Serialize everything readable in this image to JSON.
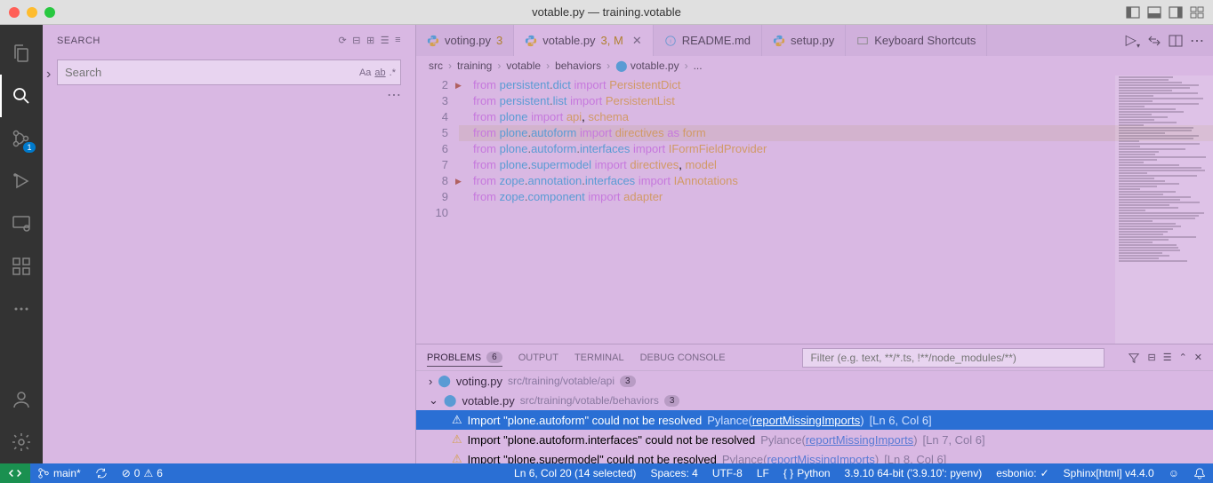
{
  "titlebar": {
    "title": "votable.py — training.votable"
  },
  "activity_bar": {
    "scm_badge": "1"
  },
  "sidebar": {
    "title": "SEARCH",
    "search_placeholder": "Search"
  },
  "tabs": [
    {
      "label": "voting.py",
      "badge": "3",
      "active": false,
      "icon": "python"
    },
    {
      "label": "votable.py",
      "badge": "3, M",
      "active": true,
      "icon": "python"
    },
    {
      "label": "README.md",
      "badge": "",
      "active": false,
      "icon": "markdown"
    },
    {
      "label": "setup.py",
      "badge": "",
      "active": false,
      "icon": "python"
    },
    {
      "label": "Keyboard Shortcuts",
      "badge": "",
      "active": false,
      "icon": "kb"
    }
  ],
  "breadcrumb": [
    "src",
    "training",
    "votable",
    "behaviors",
    "votable.py",
    "..."
  ],
  "code": {
    "start": 2,
    "lines": [
      {
        "n": 2,
        "t": "",
        "fold": true
      },
      {
        "n": 3,
        "t": "from persistent.dict import PersistentDict"
      },
      {
        "n": 4,
        "t": "from persistent.list import PersistentList"
      },
      {
        "n": 5,
        "t": "from plone import api, schema"
      },
      {
        "n": 6,
        "t": "from plone.autoform import directives as form",
        "current": true
      },
      {
        "n": 7,
        "t": "from plone.autoform.interfaces import IFormFieldProvider"
      },
      {
        "n": 8,
        "t": "from plone.supermodel import directives, model",
        "fold": true
      },
      {
        "n": 9,
        "t": "from zope.annotation.interfaces import IAnnotations"
      },
      {
        "n": 10,
        "t": "from zope.component import adapter"
      }
    ]
  },
  "panel": {
    "tabs": {
      "problems": "PROBLEMS",
      "problems_count": "6",
      "output": "OUTPUT",
      "terminal": "TERMINAL",
      "debug": "DEBUG CONSOLE"
    },
    "filter_placeholder": "Filter (e.g. text, **/*.ts, !**/node_modules/**)",
    "files": [
      {
        "name": "voting.py",
        "path": "src/training/votable/api",
        "count": "3",
        "expanded": false
      },
      {
        "name": "votable.py",
        "path": "src/training/votable/behaviors",
        "count": "3",
        "expanded": true
      }
    ],
    "problems": [
      {
        "msg": "Import \"plone.autoform\" could not be resolved",
        "source": "Pylance",
        "link": "reportMissingImports",
        "loc": "[Ln 6, Col 6]",
        "selected": true
      },
      {
        "msg": "Import \"plone.autoform.interfaces\" could not be resolved",
        "source": "Pylance",
        "link": "reportMissingImports",
        "loc": "[Ln 7, Col 6]",
        "selected": false
      },
      {
        "msg": "Import \"plone.supermodel\" could not be resolved",
        "source": "Pylance",
        "link": "reportMissingImports",
        "loc": "[Ln 8, Col 6]",
        "selected": false
      }
    ]
  },
  "statusbar": {
    "branch": "main*",
    "sync": "",
    "errors": "0",
    "warnings": "6",
    "position": "Ln 6, Col 20 (14 selected)",
    "spaces": "Spaces: 4",
    "encoding": "UTF-8",
    "eol": "LF",
    "lang": "Python",
    "interp": "3.9.10 64-bit ('3.9.10': pyenv)",
    "esbonio": "esbonio:",
    "sphinx": "Sphinx[html] v4.4.0"
  }
}
